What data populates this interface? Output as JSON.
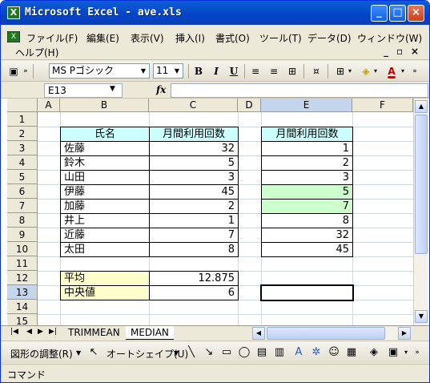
{
  "window": {
    "title": "Microsoft Excel - ave.xls"
  },
  "menu": {
    "items": [
      "ファイル(F)",
      "編集(E)",
      "表示(V)",
      "挿入(I)",
      "書式(O)",
      "ツール(T)",
      "データ(D)",
      "ウィンドウ(W)"
    ],
    "help": "ヘルプ(H)"
  },
  "toolbar": {
    "font": "MS Pゴシック",
    "size": "11",
    "bold": "B",
    "italic": "I",
    "underline": "U"
  },
  "formula_bar": {
    "name_box": "E13",
    "fx": "fx",
    "value": ""
  },
  "columns": [
    "A",
    "B",
    "C",
    "D",
    "E",
    "F"
  ],
  "rows": [
    "1",
    "2",
    "3",
    "4",
    "5",
    "6",
    "7",
    "8",
    "9",
    "10",
    "11",
    "12",
    "13",
    "14",
    "15"
  ],
  "table": {
    "header_name": "氏名",
    "header_count": "月間利用回数",
    "names": [
      "佐藤",
      "鈴木",
      "山田",
      "伊藤",
      "加藤",
      "井上",
      "近藤",
      "太田"
    ],
    "counts": [
      "32",
      "5",
      "3",
      "45",
      "2",
      "1",
      "7",
      "8"
    ]
  },
  "sorted": {
    "header": "月間利用回数",
    "values": [
      "1",
      "2",
      "3",
      "5",
      "7",
      "8",
      "32",
      "45"
    ]
  },
  "stats": {
    "avg_label": "平均",
    "avg_value": "12.875",
    "median_label": "中央値",
    "median_value": "6"
  },
  "sheets": [
    "TRIMMEAN",
    "MEDIAN"
  ],
  "drawing": {
    "draw_menu": "図形の調整(R)",
    "autoshape": "オートシェイプ(U)"
  },
  "status": "コマンド",
  "colors": {
    "header_fill": "#ccffff",
    "label_fill": "#ffffcc",
    "highlight_fill": "#ccffcc"
  }
}
